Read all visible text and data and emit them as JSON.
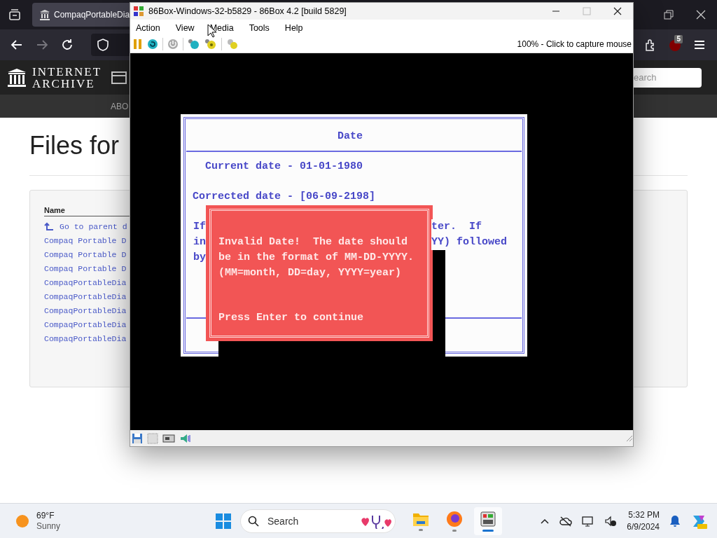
{
  "browser": {
    "tab": {
      "title": "CompaqPortableDia",
      "selected": true
    },
    "site": {
      "logo_line_1": "INTERNET",
      "logo_line_2": "ARCHIVE",
      "search": {
        "placeholder": "earch"
      },
      "nav": [
        "ABO"
      ]
    },
    "extension_badge": "5",
    "page": {
      "heading": "Files for",
      "table": {
        "columns": [
          "Name"
        ],
        "rows": [
          "Go to parent d",
          "Compaq Portable D",
          "Compaq Portable D",
          "Compaq Portable D",
          "CompaqPortableDia",
          "CompaqPortableDia",
          "CompaqPortableDia",
          "CompaqPortableDia",
          "CompaqPortableDia"
        ]
      }
    }
  },
  "emulator": {
    "title": "86Box-Windows-32-b5829 - 86Box 4.2 [build 5829]",
    "menu": [
      "Action",
      "View",
      "Media",
      "Tools",
      "Help"
    ],
    "status": "100% - Click to capture mouse",
    "screen": {
      "title": "Date",
      "current": "Current date - 01-01-1980",
      "corrected": "Corrected date - [06-09-2198]",
      "left_fragments": [
        "If",
        "in",
        "by"
      ],
      "right_fragments": [
        "ter.  If",
        "YY) followed"
      ],
      "dialog": {
        "lines": [
          "Invalid Date!  The date should",
          "be in the format of MM-DD-YYYY.",
          "(MM=month, DD=day, YYYY=year)"
        ],
        "prompt": "Press Enter to continue"
      }
    }
  },
  "taskbar": {
    "weather": {
      "temperature": "69°F",
      "condition": "Sunny"
    },
    "search": {
      "placeholder": "Search"
    },
    "apps": [
      {
        "kind": "file-explorer",
        "selected": false
      },
      {
        "kind": "firefox",
        "selected": false
      },
      {
        "kind": "emulator",
        "selected": true
      }
    ],
    "time": "5:32 PM",
    "date": "6/9/2024"
  }
}
